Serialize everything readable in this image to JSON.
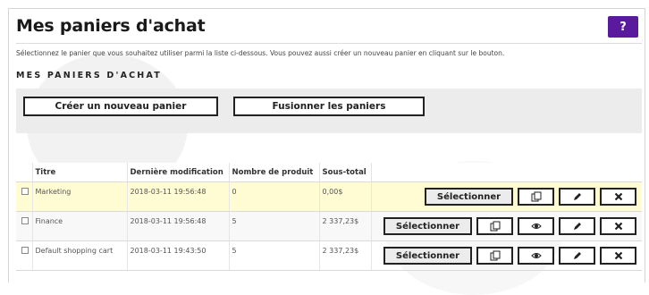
{
  "page": {
    "title": "Mes paniers d'achat",
    "help_label": "?",
    "description": "Sélectionnez le panier que vous souhaitez utiliser parmi la liste ci-dessous. Vous pouvez aussi créer un nouveau panier en cliquant sur le bouton.",
    "section_heading": "MES PANIERS D'ACHAT"
  },
  "toolbar": {
    "create_label": "Créer un nouveau panier",
    "merge_label": "Fusionner les paniers"
  },
  "table": {
    "headers": [
      "Titre",
      "Dernière modification",
      "Nombre de produit",
      "Sous-total"
    ],
    "select_label": "Sélectionner",
    "rows": [
      {
        "title": "Marketing",
        "modified": "2018-03-11 19:56:48",
        "count": "0",
        "subtotal": "0,00$",
        "active": true,
        "has_view": false
      },
      {
        "title": "Finance",
        "modified": "2018-03-11 19:56:48",
        "count": "5",
        "subtotal": "2 337,23$",
        "active": false,
        "has_view": true
      },
      {
        "title": "Default shopping cart",
        "modified": "2018-03-11 19:43:50",
        "count": "5",
        "subtotal": "2 337,23$",
        "active": false,
        "has_view": true
      }
    ]
  },
  "colors": {
    "help_button": "#5a1a9e",
    "active_row": "#fffbd3",
    "panel": "#ececec"
  },
  "icons": [
    "copy-icon",
    "eye-icon",
    "pencil-icon",
    "close-icon"
  ]
}
